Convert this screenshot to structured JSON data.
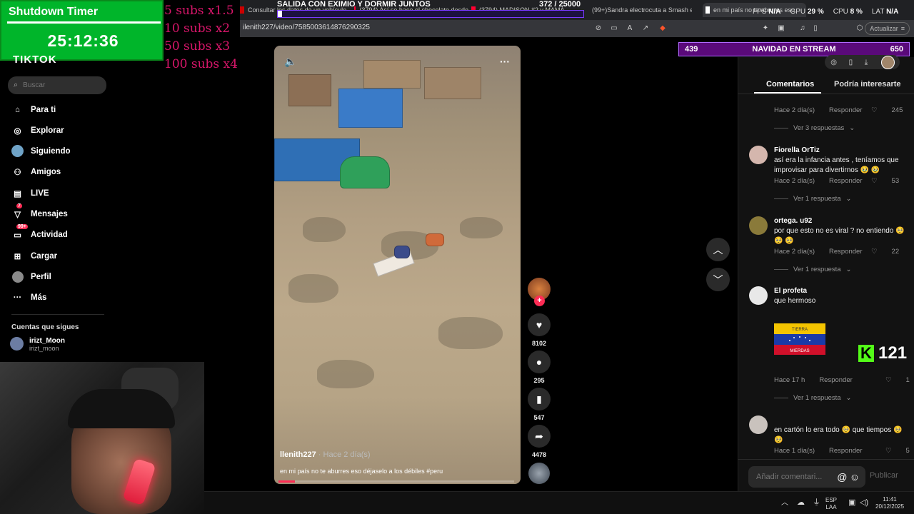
{
  "browser": {
    "tabs": [
      {
        "label": "Consultar los datos de un vehículo"
      },
      {
        "label": "(3794) Así se hace el chocolate desde"
      },
      {
        "label": "(3794) MADISON #2 y MAMÁ"
      },
      {
        "label": "(99+)Sandra electrocuta a Smash en"
      },
      {
        "label": "en mi país no te aburres eso"
      }
    ],
    "url": "ilenith227/video/7585003614876290325",
    "update_label": "Actualizar"
  },
  "overlay": {
    "timer_title": "Shutdown Timer",
    "timer_value": "25:12:36",
    "subs": [
      "5 subs x1.5",
      "10 subs x2",
      "50 subs x3",
      "100 subs x4"
    ],
    "stream_title": "SALIDA CON EXIMIO Y DORMIR JUNTOS",
    "stream_count": "372 / 25000",
    "stream_progress": 0.015,
    "perf": {
      "fps_label": "FPS",
      "fps": "N/A",
      "gpu_label": "GPU",
      "gpu": "29 %",
      "cpu_label": "CPU",
      "cpu": "8 %",
      "lat_label": "LAT",
      "lat": "N/A"
    },
    "navidad_left": "439",
    "navidad_title": "NAVIDAD EN STREAM",
    "navidad_right": "650",
    "kick_count": "121"
  },
  "sidebar": {
    "logo": "TIKTOK",
    "search_placeholder": "Buscar",
    "items": [
      {
        "label": "Para ti",
        "icon": "home-icon"
      },
      {
        "label": "Explorar",
        "icon": "compass-icon"
      },
      {
        "label": "Siguiendo",
        "icon": "following-icon"
      },
      {
        "label": "Amigos",
        "icon": "friends-icon"
      },
      {
        "label": "LIVE",
        "icon": "live-icon"
      },
      {
        "label": "Mensajes",
        "icon": "messages-icon",
        "badge": "7"
      },
      {
        "label": "Actividad",
        "icon": "activity-icon",
        "badge": "99+"
      },
      {
        "label": "Cargar",
        "icon": "upload-icon"
      },
      {
        "label": "Perfil",
        "icon": "profile-icon"
      },
      {
        "label": "Más",
        "icon": "more-icon"
      }
    ],
    "following_header": "Cuentas que sigues",
    "following": [
      {
        "name": "irizt_Moon",
        "handle": "irizt_moon"
      }
    ]
  },
  "video": {
    "username": "llenith227",
    "time": " · Hace 2 día(s)",
    "description": "en mi país no te aburres eso déjaselo a los débiles #peru",
    "progress": 0.07
  },
  "actions": {
    "likes": "8102",
    "comments": "295",
    "saves": "547",
    "shares": "4478"
  },
  "panel": {
    "tab_comments": "Comentarios",
    "tab_interest": "Podría interesarte",
    "reply_label": "Responder",
    "input_placeholder": "Añadir comentari...",
    "publish_label": "Publicar",
    "comments": [
      {
        "name": "",
        "text": "",
        "time": "Hace 2 día(s)",
        "likes": "245",
        "replies": "Ver 3 respuestas"
      },
      {
        "name": "Fiorella OrTiz",
        "text": "así era la infancia antes , teníamos que improvisar para divertirnos 🥹 🥹",
        "time": "Hace 2 día(s)",
        "likes": "53",
        "replies": "Ver 1 respuesta"
      },
      {
        "name": "ortega. u92",
        "text": "por que esto no es viral ? no entiendo 🥺 🥺 🥺",
        "time": "Hace 2 día(s)",
        "likes": "22",
        "replies": "Ver 1 respuesta"
      },
      {
        "name": "El profeta",
        "text": "que hermoso",
        "time": "Hace 17 h",
        "likes": "1",
        "replies": "Ver 1 respuesta"
      },
      {
        "name": "",
        "text": "en cartón lo era todo 🥺 que tiempos 🥺 🥺",
        "time": "Hace 1 día(s)",
        "likes": "5",
        "replies": ""
      }
    ],
    "flag_top": "TIERRA",
    "flag_bottom": "MIERDAS"
  },
  "taskbar": {
    "lang": "ESP",
    "region": "LAA",
    "time": "11:41",
    "date": "20/12/2025"
  }
}
